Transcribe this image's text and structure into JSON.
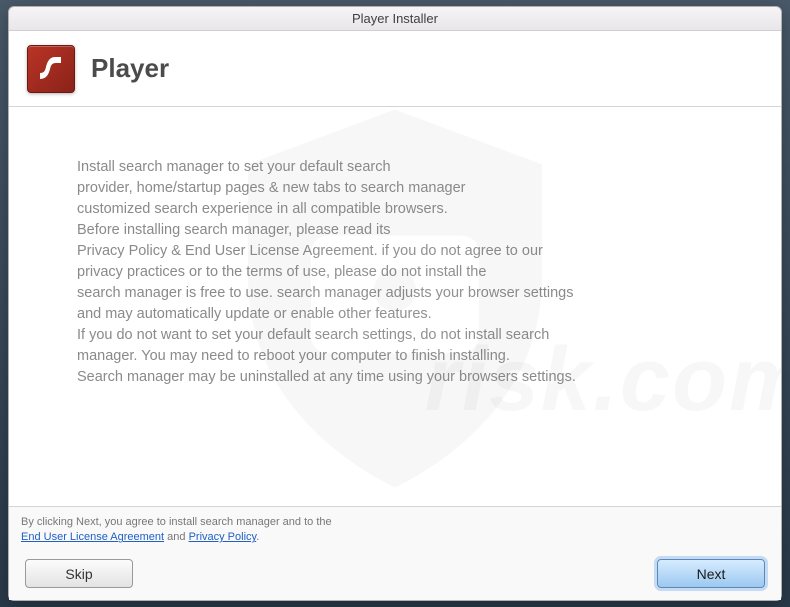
{
  "window": {
    "title": "Player Installer"
  },
  "header": {
    "title": "Player"
  },
  "body": {
    "lines": [
      "Install search manager to set your default search",
      "provider, home/startup pages & new tabs to search manager",
      "customized search experience in all compatible browsers.",
      "Before installing search manager, please read its",
      "Privacy Policy & End User License Agreement. if you do not agree to our",
      "privacy practices or to the terms of use, please do not install the",
      "search manager is free to use. search manager adjusts your browser settings",
      "and may automatically update or enable other features.",
      "If you do not want to set your default search settings, do not install search",
      "manager. You may need to reboot your computer to finish installing.",
      "Search manager may be uninstalled at any time using your browsers settings."
    ]
  },
  "footer": {
    "disclaimer_prefix": "By clicking Next, you agree to install search manager and to the ",
    "eula_link": "End User License Agreement",
    "conjunction": " and ",
    "privacy_link": "Privacy Policy",
    "period": ".",
    "skip_label": "Skip",
    "next_label": "Next"
  },
  "watermark_text": "risk.com"
}
